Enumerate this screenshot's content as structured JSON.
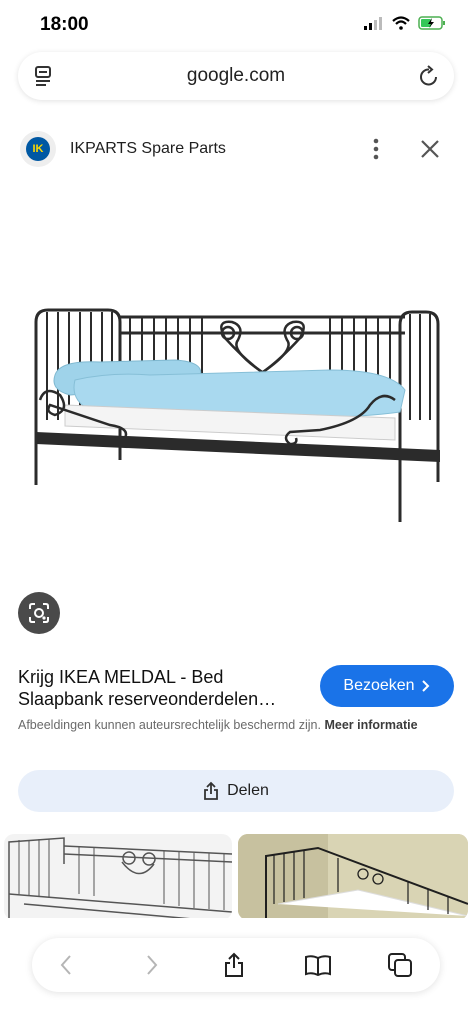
{
  "status_bar": {
    "time": "18:00"
  },
  "browser": {
    "url": "google.com"
  },
  "source": {
    "logo_text": "IK",
    "name": "IKPARTS Spare Parts"
  },
  "result": {
    "title_line1": "Krijg IKEA MELDAL - Bed",
    "title_line2": "Slaapbank reserveonderdelen…",
    "visit_label": "Bezoeken",
    "notice_text": "Afbeeldingen kunnen auteursrechtelijk beschermd zijn.",
    "notice_link": "Meer informatie",
    "share_label": "Delen"
  },
  "colors": {
    "accent": "#1a73e8",
    "share_bg": "#e8effa",
    "sheet": "#9fd3ea",
    "frame": "#2b2b2b"
  },
  "icons": [
    "tabs-icon",
    "reload-icon",
    "more-vert-icon",
    "close-icon",
    "lens-icon",
    "chevron-right-icon",
    "share-icon",
    "back-icon",
    "forward-icon",
    "bookmarks-icon",
    "tabs-overview-icon"
  ]
}
